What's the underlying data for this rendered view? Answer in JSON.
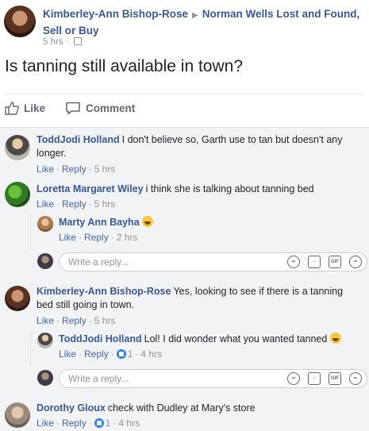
{
  "post": {
    "author": "Kimberley-Ann Bishop-Rose",
    "group": "Norman Wells Lost and Found, Sell or Buy",
    "time": "5 hrs",
    "dot": "·",
    "text": "Is tanning still available in town?"
  },
  "actions": {
    "like": "Like",
    "comment": "Comment"
  },
  "comments": [
    {
      "name": "ToddJodi Holland",
      "text": "I don't believe so, Garth use to tan but doesn't any longer.",
      "like": "Like",
      "reply": "Reply",
      "time": "5 hrs"
    },
    {
      "name": "Loretta Margaret Wiley",
      "text": "i think she is talking about tanning bed",
      "like": "Like",
      "reply": "Reply",
      "time": "5 hrs",
      "replies": [
        {
          "name": "Marty Ann Bayha",
          "text": "",
          "like": "Like",
          "reply": "Reply",
          "time": "2 hrs"
        }
      ]
    },
    {
      "name": "Kimberley-Ann Bishop-Rose",
      "text": "Yes, looking to see if there is a tanning bed still going in town.",
      "like": "Like",
      "reply": "Reply",
      "time": "5 hrs",
      "replies": [
        {
          "name": "ToddJodi Holland",
          "text": "Lol! I did wonder what you wanted tanned",
          "like": "Like",
          "reply": "Reply",
          "reactions": "1",
          "time": "4 hrs"
        }
      ]
    },
    {
      "name": "Dorothy Gloux",
      "text": "check with Dudley at Mary's store",
      "like": "Like",
      "reply": "Reply",
      "reactions": "1",
      "time": "4 hrs"
    }
  ],
  "reply_box": {
    "placeholder": "Write a reply...",
    "gif_label": "GIF"
  },
  "colors": {
    "link": "#385898",
    "muted": "#90949c",
    "comments_bg": "#f2f3f5",
    "like_blue": "#2d7ff9"
  }
}
